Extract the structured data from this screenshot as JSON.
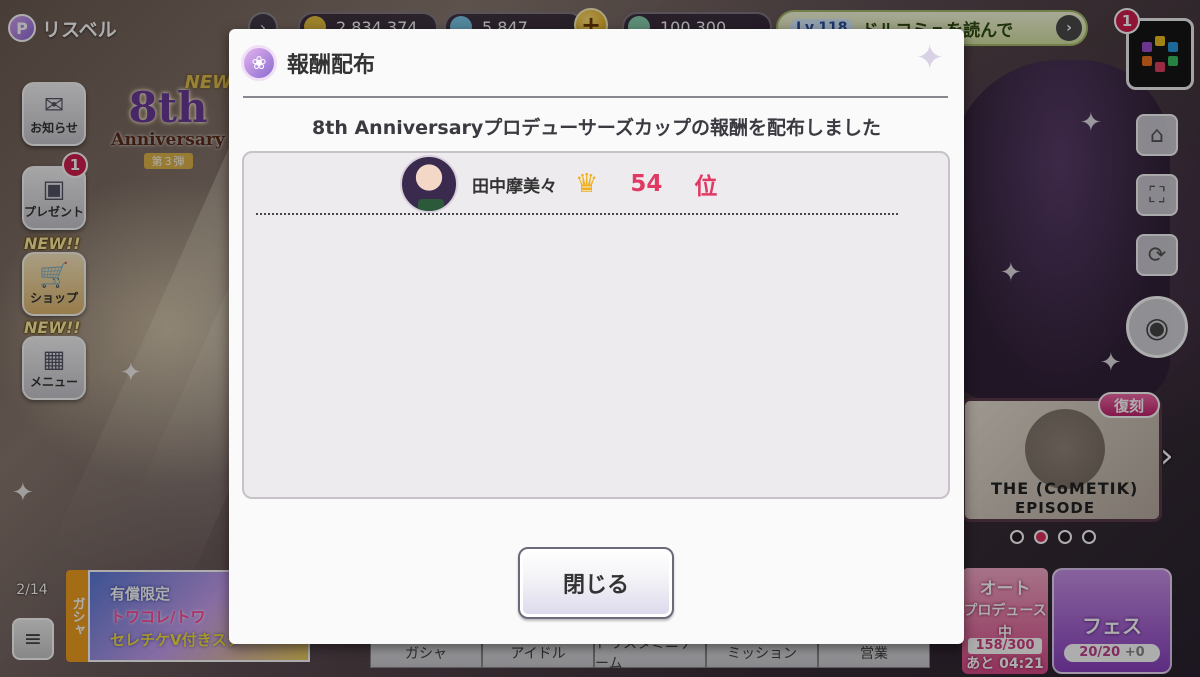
{
  "topbar": {
    "brand_label": "リスベル",
    "brand_icon": "P",
    "coins": "2,834,374",
    "jewels": "5,847",
    "money": "100,300",
    "notice_level": "Lv.118",
    "notice_text": "ドルコミュを読んで",
    "app_badge": "1"
  },
  "left": {
    "anniv_new": "NEW",
    "anniv_num": "8th",
    "anniv_word": "Anniversary",
    "anniv_phase": "第３弾",
    "mail_label": "お知らせ",
    "present_label": "プレゼント",
    "present_badge": "1",
    "shop_new": "NEW!!",
    "shop_label": "ショップ",
    "menu_new": "NEW!!",
    "menu_label": "メニュー"
  },
  "right": {
    "episode_tag": "復刻",
    "episode_line1": "THE (CoMETIK)",
    "episode_line2": "EPISODE"
  },
  "bottom": {
    "pager": "2/14",
    "gacha_tag": "ガシャ",
    "gacha_line1": "有償限定",
    "gacha_line2": "トワコレ/トワ",
    "gacha_line3": "セレチケV付きスタ",
    "nav": [
      "ガシャ",
      "アイドル",
      "ドリスタミニゲーム",
      "ミッション",
      "営業"
    ],
    "auto_label_1": "オート",
    "auto_label_2": "プロデュース中",
    "auto_count": "158/300",
    "auto_time": "あと 04:21",
    "fes_label": "フェス",
    "fes_count": "20/20",
    "fes_plus": "+0"
  },
  "modal": {
    "title": "報酬配布",
    "message": "8th Anniversaryプロデューサーズカップの報酬を配布しました",
    "idol_name": "田中摩美々",
    "rank_number": "54",
    "rank_unit": "位",
    "close_label": "閉じる"
  },
  "colors": {
    "rank": "#e03a64",
    "crown": "#f0b020",
    "badge": "#d21e4e"
  },
  "icons": {
    "modal": "reward-icon",
    "crown": "crown-icon"
  }
}
